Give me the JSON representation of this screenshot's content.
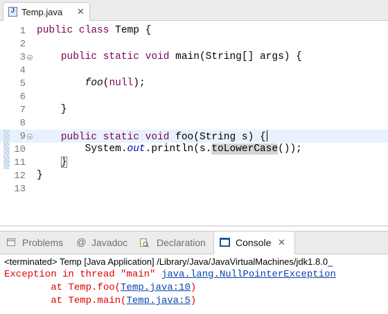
{
  "editor_tab": {
    "title": "Temp.java",
    "close_glyph": "✕",
    "icon": "java-file-icon",
    "icon_glyph": "J"
  },
  "code": [
    {
      "num": "1",
      "segs": [
        {
          "t": "public class",
          "c": "kw"
        },
        {
          "t": " Temp {"
        }
      ]
    },
    {
      "num": "2",
      "segs": []
    },
    {
      "num": "3",
      "fold": true,
      "segs": [
        {
          "t": "    "
        },
        {
          "t": "public static void",
          "c": "kw"
        },
        {
          "t": " main(String[] args) {"
        }
      ]
    },
    {
      "num": "4",
      "segs": []
    },
    {
      "num": "5",
      "segs": [
        {
          "t": "        "
        },
        {
          "t": "foo",
          "c": "it"
        },
        {
          "t": "("
        },
        {
          "t": "null",
          "c": "kw"
        },
        {
          "t": ");"
        }
      ]
    },
    {
      "num": "6",
      "segs": []
    },
    {
      "num": "7",
      "segs": [
        {
          "t": "    }"
        }
      ]
    },
    {
      "num": "8",
      "segs": []
    },
    {
      "num": "9",
      "fold": true,
      "current": true,
      "changed": true,
      "segs": [
        {
          "t": "    "
        },
        {
          "t": "public static void",
          "c": "kw"
        },
        {
          "t": " foo(String s) {"
        },
        {
          "t": "",
          "c": "caret"
        }
      ]
    },
    {
      "num": "10",
      "changed": true,
      "segs": [
        {
          "t": "        System."
        },
        {
          "t": "out",
          "c": "fld"
        },
        {
          "t": ".println(s."
        },
        {
          "t": "toLowerCase",
          "c": "occ"
        },
        {
          "t": "());"
        }
      ]
    },
    {
      "num": "11",
      "changed": true,
      "segs": [
        {
          "t": "    "
        },
        {
          "t": "}",
          "c": "brace-box"
        }
      ]
    },
    {
      "num": "12",
      "segs": [
        {
          "t": "}"
        }
      ]
    },
    {
      "num": "13",
      "segs": []
    }
  ],
  "view_tabs": [
    {
      "label": "Problems",
      "icon": "problems-icon",
      "active": false
    },
    {
      "label": "Javadoc",
      "icon": "javadoc-icon",
      "icon_glyph": "@",
      "active": false
    },
    {
      "label": "Declaration",
      "icon": "declaration-icon",
      "active": false
    },
    {
      "label": "Console",
      "icon": "console-icon",
      "active": true,
      "close_glyph": "✕"
    }
  ],
  "console": {
    "header": "<terminated> Temp [Java Application] /Library/Java/JavaVirtualMachines/jdk1.8.0_",
    "lines": [
      [
        {
          "t": "Exception in thread \"main\" "
        },
        {
          "t": "java.lang.NullPointerException",
          "link": true
        }
      ],
      [
        {
          "t": "        at Temp.foo("
        },
        {
          "t": "Temp.java:10",
          "link": true
        },
        {
          "t": ")"
        }
      ],
      [
        {
          "t": "        at Temp.main("
        },
        {
          "t": "Temp.java:5",
          "link": true
        },
        {
          "t": ")"
        }
      ]
    ]
  },
  "colors": {
    "keyword": "#7f0055",
    "field": "#0000c0",
    "error": "#e00000",
    "link": "#0645ad",
    "current_line": "#e8f2fe"
  }
}
